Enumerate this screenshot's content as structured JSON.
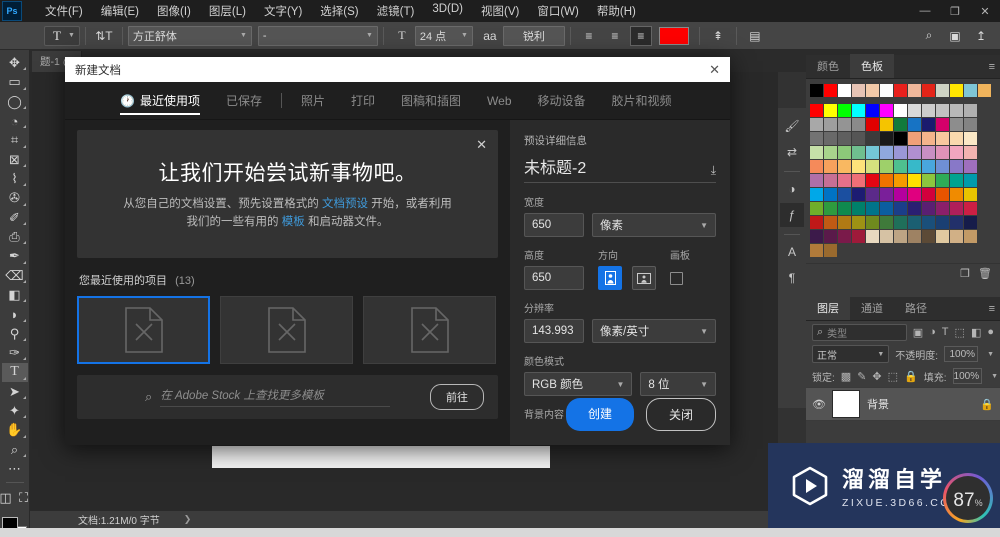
{
  "app": {
    "logo": "Ps",
    "menus": [
      "文件(F)",
      "编辑(E)",
      "图像(I)",
      "图层(L)",
      "文字(Y)",
      "选择(S)",
      "滤镜(T)",
      "3D(D)",
      "视图(V)",
      "窗口(W)",
      "帮助(H)"
    ],
    "window_controls": {
      "minimize": "—",
      "maximize": "❐",
      "close": "✕"
    },
    "right_icons": [
      {
        "name": "search-icon",
        "glyph": "⌕"
      },
      {
        "name": "workspace-icon",
        "glyph": "▣"
      },
      {
        "name": "share-icon",
        "glyph": "↥"
      }
    ]
  },
  "options_bar": {
    "tool_glyph": "T",
    "orientation_glyph": "⇅T",
    "font_family": "方正舒体",
    "font_style": "-",
    "font_size": "24 点",
    "antialias_icon": "aa",
    "antialias_value": "锐利",
    "align": [
      "left",
      "center",
      "right"
    ],
    "align_active": "right",
    "color_swatch": "#fe0000",
    "warp_icon": "⇞",
    "panel_icon": "▤"
  },
  "doc_tab": {
    "label": "题-1 @"
  },
  "toolbar": {
    "tools": [
      {
        "name": "move-tool",
        "glyph": "✥"
      },
      {
        "name": "marquee-tool",
        "glyph": "▭"
      },
      {
        "name": "lasso-tool",
        "glyph": "◯"
      },
      {
        "name": "quick-selection-tool",
        "glyph": "✎"
      },
      {
        "name": "crop-tool",
        "glyph": "⌗"
      },
      {
        "name": "frame-tool",
        "glyph": "⊠"
      },
      {
        "name": "eyedropper-tool",
        "glyph": "⌇"
      },
      {
        "name": "healing-brush-tool",
        "glyph": "⚕"
      },
      {
        "name": "brush-tool",
        "glyph": "✐"
      },
      {
        "name": "clone-stamp-tool",
        "glyph": "⎙"
      },
      {
        "name": "history-brush-tool",
        "glyph": "✒"
      },
      {
        "name": "eraser-tool",
        "glyph": "⌫"
      },
      {
        "name": "gradient-tool",
        "glyph": "◨"
      },
      {
        "name": "blur-tool",
        "glyph": "💧"
      },
      {
        "name": "dodge-tool",
        "glyph": "⚲"
      },
      {
        "name": "pen-tool",
        "glyph": "✑"
      },
      {
        "name": "type-tool",
        "glyph": "T"
      },
      {
        "name": "path-selection-tool",
        "glyph": "➤"
      },
      {
        "name": "shape-tool",
        "glyph": "✦"
      },
      {
        "name": "hand-tool",
        "glyph": "✋"
      },
      {
        "name": "zoom-tool",
        "glyph": "⌕"
      },
      {
        "name": "more-tools",
        "glyph": "⋯"
      },
      {
        "name": "quickmask-tool",
        "glyph": "◫"
      },
      {
        "name": "screenmode-tool",
        "glyph": "⛶"
      }
    ],
    "selected_tool": "type-tool",
    "foreground_color": "#000000",
    "background_color": "#ffffff"
  },
  "status_bar": {
    "zoom": "",
    "doc_info": "文档:1.21M/0 字节",
    "arrow": "❯"
  },
  "panel_rail": [
    {
      "name": "brush-icon",
      "glyph": "🖌"
    },
    {
      "name": "brush-settings-icon",
      "glyph": "⇄"
    },
    {
      "name": "adjustments-icon",
      "glyph": "◑"
    },
    {
      "name": "styles-icon",
      "glyph": "ƒ",
      "active": true
    },
    {
      "name": "character-icon",
      "glyph": "A"
    },
    {
      "name": "paragraph-icon",
      "glyph": "¶"
    }
  ],
  "swatches_panel": {
    "tabs": [
      "颜色",
      "色板"
    ],
    "active_tab": "色板",
    "menu_icon": "≡",
    "footer_icons": [
      {
        "name": "new-swatch-icon",
        "glyph": "❐"
      },
      {
        "name": "delete-swatch-icon",
        "glyph": "🗑"
      }
    ],
    "top_row": [
      "#000000",
      "#ff0000",
      "#ffffff",
      "#e6c3b4",
      "#f2c9a8",
      "#fdfdfd",
      "#e8201c",
      "#f0b79a",
      "#e32418",
      "#cfd4c4",
      "#ffe500",
      "#7fc6d6",
      "#f0b45c"
    ],
    "grid": [
      [
        "#ff0000",
        "#ffff00",
        "#00ff00",
        "#00ffff",
        "#0000ff",
        "#ff00ff",
        "#ffffff",
        "#d9d9d9",
        "#cccccc",
        "#c2c2c2",
        "#b8b8b8",
        "#b0b0b0"
      ],
      [
        "#a8a8a8",
        "#9e9e9e",
        "#949494",
        "#8a8a8a",
        "#e00000",
        "#f5c400",
        "#117a3b",
        "#1773c4",
        "#1b1b6e",
        "#d4006a",
        "#8d8d8d",
        "#838383"
      ],
      [
        "#737373",
        "#696969",
        "#5f5f5f",
        "#555555",
        "#3b3b3b",
        "#1a1a1a",
        "#000000",
        "#f0a079",
        "#f5b48b",
        "#f7c89e",
        "#f9d9ae",
        "#fbe8c6"
      ],
      [
        "#c6e0a8",
        "#a8d48c",
        "#8cc979",
        "#6fbf8f",
        "#74c7d6",
        "#8fa8dd",
        "#9a97d6",
        "#b08fd0",
        "#c98fc2",
        "#e093b8",
        "#f2a6bf",
        "#f2b3b0"
      ],
      [
        "#f58a5a",
        "#f7a15c",
        "#f9b861",
        "#fde27a",
        "#d5e07e",
        "#9ed06a",
        "#4ec08f",
        "#37b9c9",
        "#49a6dd",
        "#6f8fd4",
        "#8878c8",
        "#9f6fbd"
      ],
      [
        "#b06fa8",
        "#c76f95",
        "#e5708a",
        "#ef6f77",
        "#e30613",
        "#f07300",
        "#f59b00",
        "#ffe000",
        "#8cc63e",
        "#2eab57",
        "#00a390",
        "#009bab"
      ],
      [
        "#00a8e8",
        "#0073c4",
        "#1b4fa0",
        "#1c1c72",
        "#5b2a8a",
        "#7a1f9a",
        "#b4009e",
        "#e0007f",
        "#d2003c",
        "#e85400",
        "#f08b00",
        "#e8c400"
      ],
      [
        "#6fae2a",
        "#2e9b3f",
        "#0f8a4e",
        "#00806a",
        "#00748a",
        "#0b5ea0",
        "#1b3e8a",
        "#2a1f72",
        "#5a1f72",
        "#8a1f6a",
        "#b01f5a",
        "#cc1f44"
      ],
      [
        "#c01818",
        "#c05a14",
        "#b07a14",
        "#9e9214",
        "#6f8a1e",
        "#3f7a3a",
        "#1f6f5a",
        "#1b5f72",
        "#1a4f7a",
        "#1a3f72",
        "#22306a",
        "#161c4a"
      ],
      [
        "#3c1a4a",
        "#5a1a4a",
        "#7a1a4a",
        "#9e1a3a",
        "#e8d9c0",
        "#d6c2a4",
        "#bda484",
        "#9e8263",
        "#5c4a36",
        "#e0c9a0",
        "#d1b086",
        "#c29a66"
      ],
      [
        "#b07a3a",
        "#9a6a2e"
      ]
    ]
  },
  "layers_panel": {
    "tabs": [
      "图层",
      "通道",
      "路径"
    ],
    "active_tab": "图层",
    "menu_icon": "≡",
    "filter_placeholder": "类型",
    "filter_icons": [
      "▣",
      "◑",
      "T",
      "⬚",
      "◧"
    ],
    "toggle_icon": "●",
    "blend_mode": "正常",
    "opacity_label": "不透明度:",
    "opacity_value": "100%",
    "lock_label": "锁定:",
    "lock_icons": [
      "▩",
      "✎",
      "✥",
      "⬚",
      "🔒"
    ],
    "fill_label": "填充:",
    "fill_value": "100%",
    "layers": [
      {
        "name": "背景",
        "visible": true,
        "locked": true,
        "thumb_color": "#ffffff"
      }
    ]
  },
  "dialog": {
    "title": "新建文档",
    "close_icon": "✕",
    "tabs": [
      {
        "label": "最近使用项",
        "icon": "🕐",
        "active": true
      },
      {
        "label": "已保存",
        "active": false
      },
      {
        "label": "照片",
        "active": false
      },
      {
        "label": "打印",
        "active": false
      },
      {
        "label": "图稿和插图",
        "active": false
      },
      {
        "label": "Web",
        "active": false
      },
      {
        "label": "移动设备",
        "active": false
      },
      {
        "label": "胶片和视频",
        "active": false
      }
    ],
    "promo": {
      "close_icon": "✕",
      "heading": "让我们开始尝试新事物吧。",
      "body_1": "从您自己的文档设置、预先设置格式的 ",
      "link_1": "文档预设",
      "body_2": " 开始，或者利用我们的一些有用的 ",
      "link_2": "模板",
      "body_3": " 和启动器文件。"
    },
    "recent": {
      "heading": "您最近使用的项目",
      "count": "(13)",
      "cards": [
        {
          "name": "recent-item-1",
          "selected": true
        },
        {
          "name": "recent-item-2",
          "selected": false
        },
        {
          "name": "recent-item-3",
          "selected": false
        }
      ]
    },
    "stock": {
      "search_icon": "⌕",
      "placeholder": "在 Adobe Stock 上查找更多模板",
      "button": "前往"
    },
    "preset": {
      "section_title": "预设详细信息",
      "name": "未标题-2",
      "save_icon": "⤓",
      "width_label": "宽度",
      "width_value": "650",
      "width_unit": "像素",
      "height_label": "高度",
      "height_value": "650",
      "orientation_label": "方向",
      "orientation_portrait": "portrait",
      "orientation_landscape": "landscape",
      "orientation_selected": "portrait",
      "artboard_label": "画板",
      "artboard_checked": false,
      "resolution_label": "分辨率",
      "resolution_value": "143.993",
      "resolution_unit": "像素/英寸",
      "colormode_label": "颜色模式",
      "colormode_value": "RGB 颜色",
      "bitdepth_value": "8 位",
      "background_label": "背景内容"
    },
    "actions": {
      "create": "创建",
      "close": "关闭"
    }
  },
  "watermark": {
    "cn": "溜溜自学",
    "en": "ZIXUE.3D66.COM",
    "play_icon": "▶",
    "progress_value": "87",
    "progress_unit": "%",
    "bg_color": "#24355c"
  }
}
